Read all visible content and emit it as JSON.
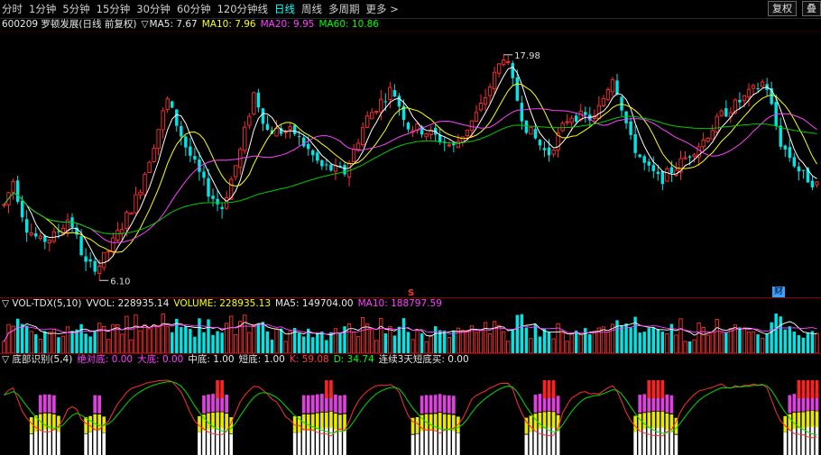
{
  "toolbar": {
    "periods": [
      "分时",
      "1分钟",
      "5分钟",
      "15分钟",
      "30分钟",
      "60分钟",
      "120分钟线",
      "日线",
      "周线",
      "多周期",
      "更多 >"
    ],
    "active_index": 7,
    "right_buttons": [
      "复权",
      "叠"
    ]
  },
  "main_panel": {
    "stock_title": "600209 罗顿发展(日线 前复权)",
    "ma_marker": "▽",
    "ma5": "MA5: 7.67",
    "ma10": "MA10: 7.96",
    "ma20": "MA20: 9.95",
    "ma60": "MA60: 10.86",
    "high_label": "17.98",
    "low_label": "6.10",
    "marker_s": "S",
    "marker_right": "财"
  },
  "volume_panel": {
    "title": "▽ VOL-TDX(5,10)",
    "vvol": "VVOL: 228935.14",
    "volume": "VOLUME: 228935.13",
    "ma5": "MA5: 149704.00",
    "ma10": "MA10: 188797.59"
  },
  "indicator_panel": {
    "title": "▽ 底部识别(5,4)",
    "absolute_bottom": "绝对底: 0.00",
    "big_bottom": "大底: 0.00",
    "mid_bottom": "中底: 1.00",
    "short_bottom": "短底: 1.00",
    "k": "K: 59.08",
    "d": "D: 34.74",
    "three_day": "连续3天短底买: 0.00"
  },
  "colors": {
    "up": "#ff3030",
    "down": "#00e5e5",
    "ma5": "#ffffff",
    "ma10": "#ffff00",
    "ma20": "#ff40ff",
    "ma60": "#00cc00",
    "bg": "#000000"
  }
}
